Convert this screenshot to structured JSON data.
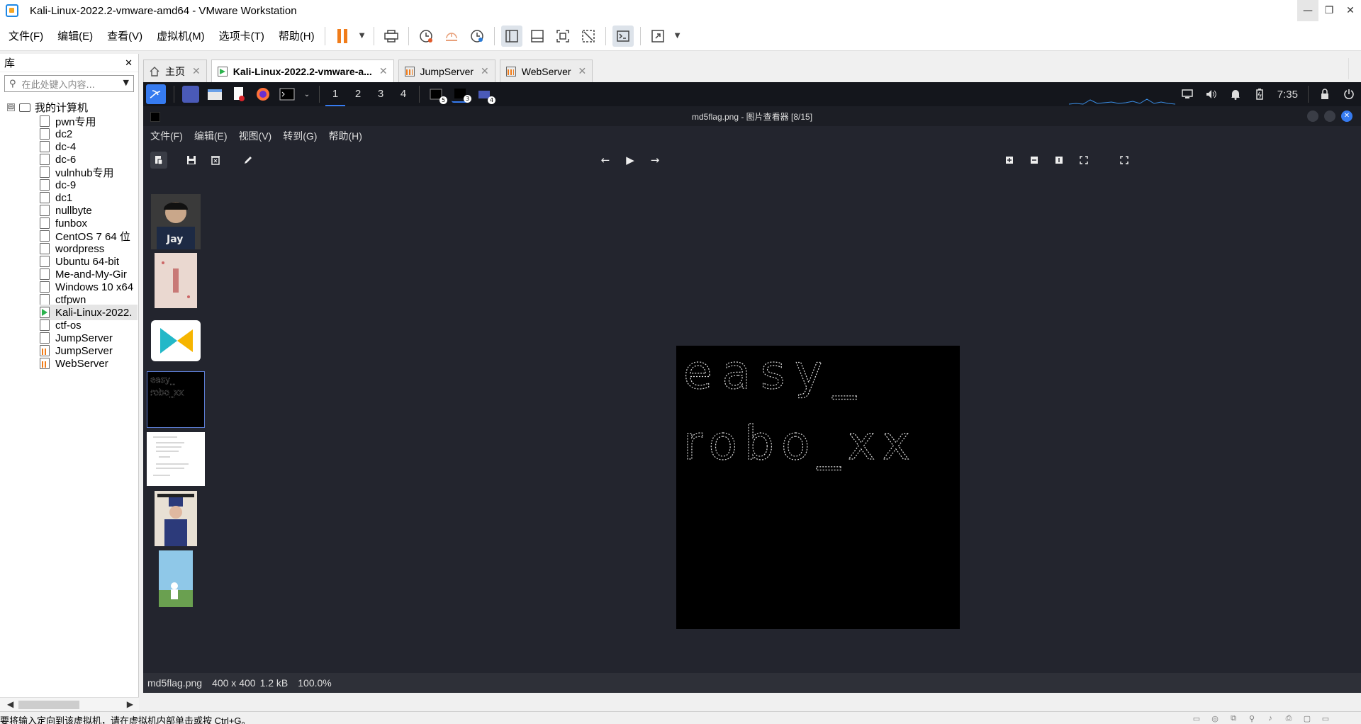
{
  "window": {
    "title": "Kali-Linux-2022.2-vmware-amd64 - VMware Workstation",
    "minimize_glyph": "—",
    "maximize_glyph": "❐",
    "close_glyph": "✕"
  },
  "menu": {
    "items": [
      "文件(F)",
      "编辑(E)",
      "查看(V)",
      "虚拟机(M)",
      "选项卡(T)",
      "帮助(H)"
    ]
  },
  "library": {
    "title": "库",
    "close_glyph": "✕",
    "search_placeholder": "在此处键入内容...",
    "root_label": "我的计算机",
    "root_expander": "⊟",
    "vms": [
      {
        "name": "pwn专用",
        "state": "off"
      },
      {
        "name": "dc2",
        "state": "off"
      },
      {
        "name": "dc-4",
        "state": "off"
      },
      {
        "name": "dc-6",
        "state": "off"
      },
      {
        "name": "vulnhub专用",
        "state": "off"
      },
      {
        "name": "dc-9",
        "state": "off"
      },
      {
        "name": "dc1",
        "state": "off"
      },
      {
        "name": "nullbyte",
        "state": "off"
      },
      {
        "name": "funbox",
        "state": "off"
      },
      {
        "name": "CentOS 7 64 位",
        "state": "off"
      },
      {
        "name": "wordpress",
        "state": "off"
      },
      {
        "name": "Ubuntu 64-bit",
        "state": "off"
      },
      {
        "name": "Me-and-My-Gir",
        "state": "off"
      },
      {
        "name": "Windows 10 x64",
        "state": "off"
      },
      {
        "name": "ctfpwn",
        "state": "off"
      },
      {
        "name": "Kali-Linux-2022.",
        "state": "running"
      },
      {
        "name": "ctf-os",
        "state": "off"
      },
      {
        "name": "JumpServer",
        "state": "off"
      },
      {
        "name": "JumpServer",
        "state": "server"
      },
      {
        "name": "WebServer",
        "state": "server"
      }
    ]
  },
  "tabs": [
    {
      "label": "主页",
      "icon": "home-icon",
      "close": "✕"
    },
    {
      "label": "Kali-Linux-2022.2-vmware-a...",
      "icon": "vm-running-icon",
      "close": "✕",
      "active": true
    },
    {
      "label": "JumpServer",
      "icon": "vm-server-icon",
      "close": "✕"
    },
    {
      "label": "WebServer",
      "icon": "vm-server-icon",
      "close": "✕"
    }
  ],
  "kali_panel": {
    "workspaces": [
      "1",
      "2",
      "3",
      "4"
    ],
    "badges": [
      "5",
      "3",
      "4"
    ],
    "clock": "7:35"
  },
  "viewer": {
    "title": "md5flag.png - 图片查看器 [8/15]",
    "menu": [
      "文件(F)",
      "编辑(E)",
      "视图(V)",
      "转到(G)",
      "帮助(H)"
    ],
    "image_text_line1": "easy_",
    "image_text_line2": "robo_xx",
    "thumb_label": "Jay",
    "status": {
      "filename": "md5flag.png",
      "dimensions": "400 x 400",
      "size": "1.2 kB",
      "zoom": "100.0%"
    }
  },
  "statusbar": {
    "hint": "要将输入定向到该虚拟机，请在虚拟机内部单击或按 Ctrl+G。"
  },
  "colors": {
    "accent": "#367bf0",
    "pause": "#f07c1a",
    "running": "#2bb24c",
    "vm_bg": "#23252e",
    "panel_bg": "#14161c"
  }
}
